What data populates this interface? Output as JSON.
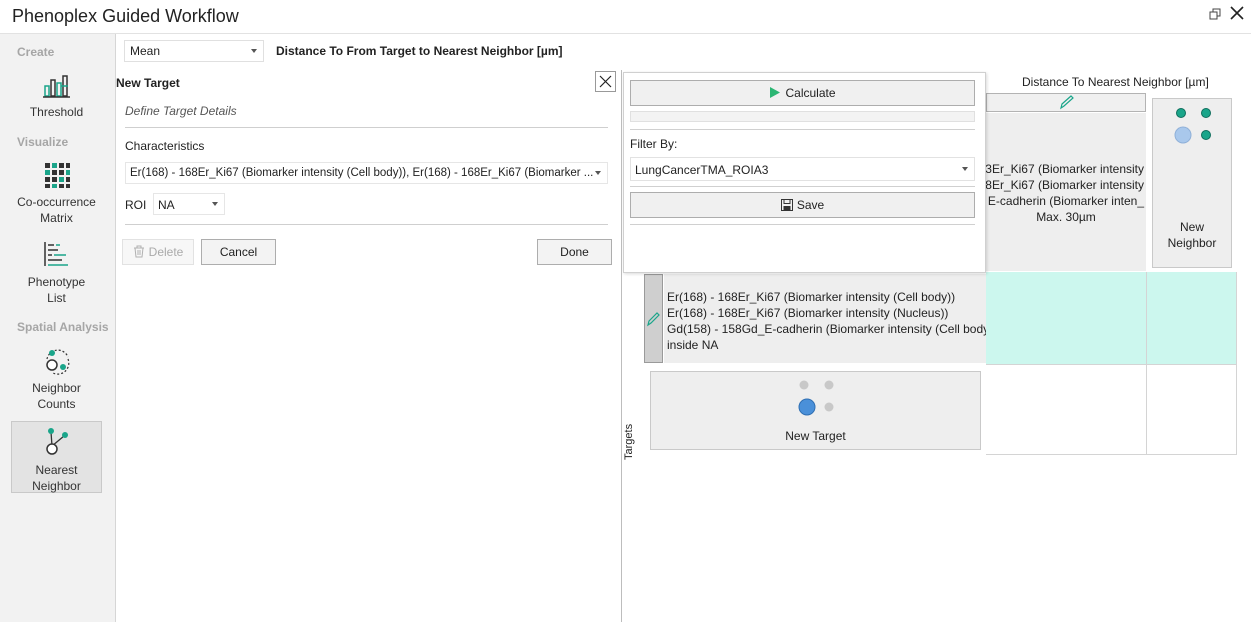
{
  "window": {
    "title": "Phenoplex Guided Workflow"
  },
  "sidebar": {
    "sections": {
      "create": "Create",
      "visualize": "Visualize",
      "spatial": "Spatial Analysis"
    },
    "items": [
      {
        "label": "Threshold",
        "icon": "threshold-icon"
      },
      {
        "label": "Co-occurrence Matrix",
        "line1": "Co-occurrence",
        "line2": "Matrix",
        "icon": "matrix-grid-icon"
      },
      {
        "label": "Phenotype List",
        "line1": "Phenotype",
        "line2": "List",
        "icon": "phenotype-list-icon"
      },
      {
        "label": "Neighbor Counts",
        "line1": "Neighbor",
        "line2": "Counts",
        "icon": "neighbor-counts-icon"
      },
      {
        "label": "Nearest Neighbor",
        "line1": "Nearest",
        "line2": "Neighbor",
        "icon": "nearest-neighbor-icon",
        "active": true
      }
    ]
  },
  "topbar": {
    "aggregate_value": "Mean",
    "measure_label": "Distance To From Target to Nearest Neighbor [µm]"
  },
  "target_panel": {
    "title": "New Target",
    "subtitle": "Define Target Details",
    "characteristics_label": "Characteristics",
    "characteristics_value": "Er(168) - 168Er_Ki67 (Biomarker intensity (Cell body)), Er(168) - 168Er_Ki67 (Biomarker ...",
    "roi_label": "ROI",
    "roi_value": "NA",
    "delete_label": "Delete",
    "cancel_label": "Cancel",
    "done_label": "Done"
  },
  "popup": {
    "calculate_label": "Calculate",
    "filter_label": "Filter By:",
    "filter_value": "LungCancerTMA_ROIA3",
    "save_label": "Save"
  },
  "matrix": {
    "column_header": "Distance To Nearest Neighbor [µm]",
    "neighbor_lines": [
      "3Er_Ki67 (Biomarker intensity",
      "8Er_Ki67 (Biomarker intensity",
      "_E-cadherin (Biomarker inten"
    ],
    "neighbor_max": "Max. 30µm",
    "new_neighbor_line1": "New",
    "new_neighbor_line2": "Neighbor",
    "target_lines": [
      "Er(168) - 168Er_Ki67 (Biomarker intensity (Cell body))",
      "Er(168) - 168Er_Ki67 (Biomarker intensity (Nucleus))",
      "Gd(158) - 158Gd_E-cadherin (Biomarker intensity (Cell body)",
      "inside NA"
    ],
    "new_target_label": "New Target",
    "targets_axis_label": "Targets"
  },
  "colors": {
    "accent_teal": "#1aa58a",
    "cell_highlight": "#ccf7ee",
    "play_green": "#2bb673",
    "dot_blue": "#4a90d9"
  }
}
